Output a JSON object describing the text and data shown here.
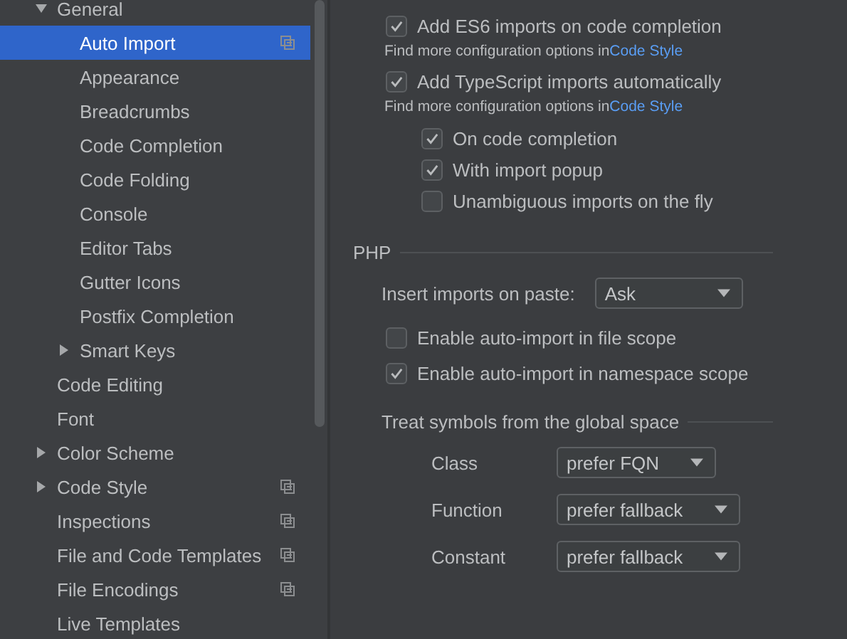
{
  "sidebar": {
    "items": [
      {
        "label": "General",
        "selected": false,
        "expanded": true,
        "badge": false,
        "children": [
          {
            "label": "Auto Import",
            "selected": true,
            "badge": true
          },
          {
            "label": "Appearance",
            "selected": false,
            "badge": false
          },
          {
            "label": "Breadcrumbs",
            "selected": false,
            "badge": false
          },
          {
            "label": "Code Completion",
            "selected": false,
            "badge": false
          },
          {
            "label": "Code Folding",
            "selected": false,
            "badge": false
          },
          {
            "label": "Console",
            "selected": false,
            "badge": false
          },
          {
            "label": "Editor Tabs",
            "selected": false,
            "badge": false
          },
          {
            "label": "Gutter Icons",
            "selected": false,
            "badge": false
          },
          {
            "label": "Postfix Completion",
            "selected": false,
            "badge": false
          },
          {
            "label": "Smart Keys",
            "selected": false,
            "expanded": false,
            "badge": false
          }
        ]
      },
      {
        "label": "Code Editing",
        "selected": false,
        "badge": false
      },
      {
        "label": "Font",
        "selected": false,
        "badge": false
      },
      {
        "label": "Color Scheme",
        "selected": false,
        "expanded": false,
        "badge": false
      },
      {
        "label": "Code Style",
        "selected": false,
        "expanded": false,
        "badge": true
      },
      {
        "label": "Inspections",
        "selected": false,
        "badge": true
      },
      {
        "label": "File and Code Templates",
        "selected": false,
        "badge": true
      },
      {
        "label": "File Encodings",
        "selected": false,
        "badge": true
      },
      {
        "label": "Live Templates",
        "selected": false,
        "badge": false
      }
    ]
  },
  "javascript": {
    "options": [
      {
        "label": "Add ES6 imports on code completion",
        "checked": true,
        "hint": "Find more configuration options in",
        "link": "Code Style"
      },
      {
        "label": "Add TypeScript imports automatically",
        "checked": true,
        "hint": "Find more configuration options in",
        "link": "Code Style",
        "children": [
          {
            "label": "On code completion",
            "checked": true
          },
          {
            "label": "With import popup",
            "checked": true
          },
          {
            "label": "Unambiguous imports on the fly",
            "checked": false
          }
        ]
      }
    ]
  },
  "php": {
    "title": "PHP",
    "paste": {
      "label": "Insert imports on paste:",
      "value": "Ask"
    },
    "options": [
      {
        "label": "Enable auto-import in file scope",
        "checked": false
      },
      {
        "label": "Enable auto-import in namespace scope",
        "checked": true
      }
    ],
    "global": {
      "title": "Treat symbols from the global space",
      "rows": [
        {
          "label": "Class",
          "value": "prefer FQN"
        },
        {
          "label": "Function",
          "value": "prefer fallback"
        },
        {
          "label": "Constant",
          "value": "prefer fallback"
        }
      ]
    }
  }
}
